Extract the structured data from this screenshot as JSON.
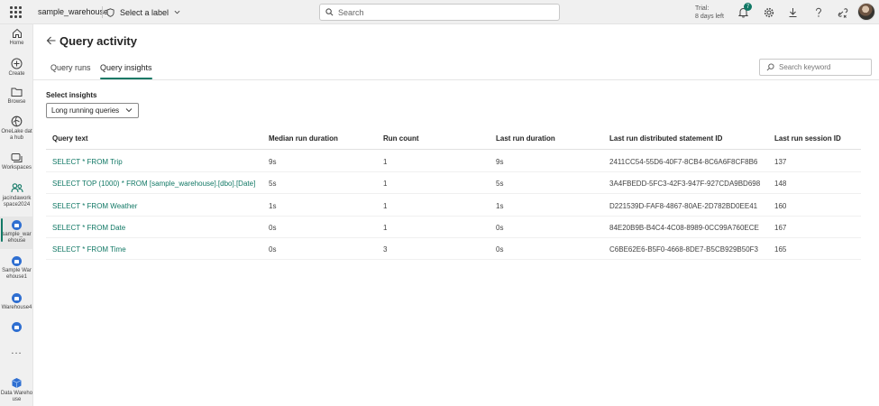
{
  "topbar": {
    "workspace": "sample_warehouse",
    "label_picker": "Select a label",
    "search_placeholder": "Search",
    "trial_line1": "Trial:",
    "trial_line2": "8 days left",
    "notification_count": "7"
  },
  "rail": {
    "items": [
      {
        "label": "Home",
        "icon": "home-icon"
      },
      {
        "label": "Create",
        "icon": "plus-circle-icon"
      },
      {
        "label": "Browse",
        "icon": "folder-icon"
      },
      {
        "label": "OneLake data hub",
        "icon": "onelake-icon"
      },
      {
        "label": "Workspaces",
        "icon": "workspaces-icon"
      },
      {
        "label": "jacindawork space2024",
        "icon": "people-icon"
      },
      {
        "label": "sample_war ehouse",
        "icon": "warehouse-icon"
      },
      {
        "label": "Sample Warehouse1",
        "icon": "warehouse-icon"
      },
      {
        "label": "Warehouse4",
        "icon": "warehouse-icon"
      },
      {
        "label": "",
        "icon": "warehouse-icon"
      },
      {
        "label": "...",
        "icon": "more-icon"
      },
      {
        "label": "Data Warehouse",
        "icon": "data-warehouse-icon"
      }
    ]
  },
  "page": {
    "title": "Query activity",
    "tabs": [
      {
        "label": "Query runs",
        "active": false
      },
      {
        "label": "Query insights",
        "active": true
      }
    ],
    "keyword_placeholder": "Search keyword",
    "select_insights_label": "Select insights",
    "selected_insight": "Long running queries"
  },
  "table": {
    "columns": [
      "Query text",
      "Median run duration",
      "Run count",
      "Last run duration",
      "Last run distributed statement ID",
      "Last run session ID"
    ],
    "rows": [
      [
        "SELECT * FROM Trip",
        "9s",
        "1",
        "9s",
        "2411CC54-55D6-40F7-8CB4-8C6A6F8CF8B6",
        "137"
      ],
      [
        "SELECT TOP (1000) * FROM [sample_warehouse].[dbo].[Date]",
        "5s",
        "1",
        "5s",
        "3A4FBEDD-5FC3-42F3-947F-927CDA9BD698",
        "148"
      ],
      [
        "SELECT * FROM Weather",
        "1s",
        "1",
        "1s",
        "D221539D-FAF8-4867-80AE-2D782BD0EE41",
        "160"
      ],
      [
        "SELECT * FROM Date",
        "0s",
        "1",
        "0s",
        "84E20B9B-B4C4-4C08-8989-0CC99A760ECE",
        "167"
      ],
      [
        "SELECT * FROM Time",
        "0s",
        "3",
        "0s",
        "C6BE62E6-B5F0-4668-8DE7-B5CB929B50F3",
        "165"
      ]
    ]
  },
  "colors": {
    "accent": "#117865",
    "topbar_bg": "#f0f0f0",
    "warehouse_icon": "#2f6fd1"
  }
}
